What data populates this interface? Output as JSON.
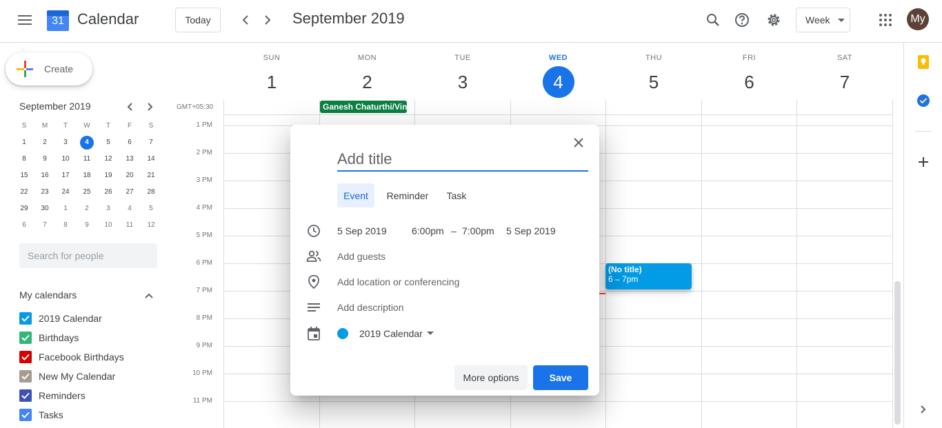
{
  "header": {
    "app_title": "Calendar",
    "logo_day": "31",
    "today_label": "Today",
    "month_title": "September 2019",
    "view_label": "Week",
    "avatar_text": "My"
  },
  "sidebar": {
    "create_label": "Create",
    "mini_calendar": {
      "title": "September 2019",
      "weekday_headers": [
        "S",
        "M",
        "T",
        "W",
        "T",
        "F",
        "S"
      ],
      "weeks": [
        [
          "1",
          "2",
          "3",
          "4",
          "5",
          "6",
          "7"
        ],
        [
          "8",
          "9",
          "10",
          "11",
          "12",
          "13",
          "14"
        ],
        [
          "15",
          "16",
          "17",
          "18",
          "19",
          "20",
          "21"
        ],
        [
          "22",
          "23",
          "24",
          "25",
          "26",
          "27",
          "28"
        ],
        [
          "29",
          "30",
          "1",
          "2",
          "3",
          "4",
          "5"
        ],
        [
          "6",
          "7",
          "8",
          "9",
          "10",
          "11",
          "12"
        ]
      ],
      "today": "4"
    },
    "people_search_placeholder": "Search for people",
    "my_calendars_title": "My calendars",
    "calendars": [
      {
        "label": "2019 Calendar",
        "color": "#039be5"
      },
      {
        "label": "Birthdays",
        "color": "#33b679"
      },
      {
        "label": "Facebook Birthdays",
        "color": "#d50000"
      },
      {
        "label": "New My Calendar",
        "color": "#a79b8e"
      },
      {
        "label": "Reminders",
        "color": "#3f51b5"
      },
      {
        "label": "Tasks",
        "color": "#4285f4"
      }
    ]
  },
  "week": {
    "timezone": "GMT+05:30",
    "days": [
      {
        "name": "SUN",
        "num": "1"
      },
      {
        "name": "MON",
        "num": "2"
      },
      {
        "name": "TUE",
        "num": "3"
      },
      {
        "name": "WED",
        "num": "4",
        "today": true
      },
      {
        "name": "THU",
        "num": "5"
      },
      {
        "name": "FRI",
        "num": "6"
      },
      {
        "name": "SAT",
        "num": "7"
      }
    ],
    "hours": [
      "1 PM",
      "2 PM",
      "3 PM",
      "4 PM",
      "5 PM",
      "6 PM",
      "7 PM",
      "8 PM",
      "9 PM",
      "10 PM",
      "11 PM"
    ],
    "allday_event": "Ganesh Chaturthi/Vinayaka Chaturthi",
    "draft_event": {
      "title": "(No title)",
      "time": "6 – 7pm"
    }
  },
  "dialog": {
    "title_placeholder": "Add title",
    "tabs": [
      "Event",
      "Reminder",
      "Task"
    ],
    "start_date": "5 Sep 2019",
    "start_time": "6:00pm",
    "dash": "–",
    "end_time": "7:00pm",
    "end_date": "5 Sep 2019",
    "add_guests": "Add guests",
    "add_location": "Add location or conferencing",
    "add_description": "Add description",
    "calendar": "2019 Calendar",
    "calendar_color": "#039be5",
    "more_options": "More options",
    "save": "Save"
  },
  "colors": {
    "accent": "#1a73e8",
    "holiday": "#0b8043",
    "event": "#039be5"
  }
}
